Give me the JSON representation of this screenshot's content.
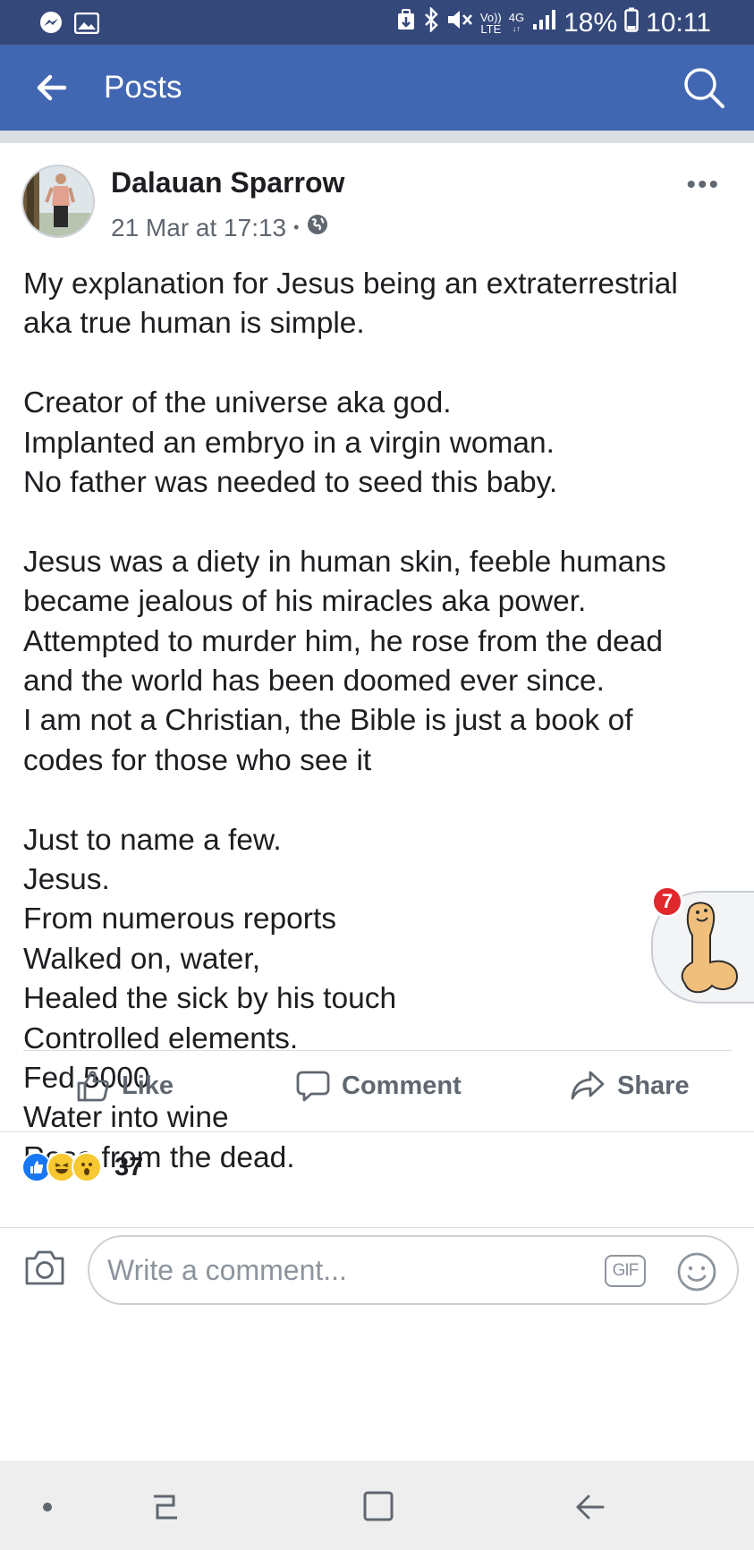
{
  "status_bar": {
    "network_top": "Vo))",
    "network_bottom": "LTE",
    "signal_gen_top": "4G",
    "signal_gen_bottom": "↓↑",
    "battery": "18%",
    "time": "10:11"
  },
  "app_bar": {
    "title": "Posts"
  },
  "post": {
    "author": "Dalauan Sparrow",
    "timestamp": "21 Mar at 17:13",
    "separator": "•",
    "more_label": "•••",
    "paragraphs": [
      [
        "My explanation for Jesus being an extraterrestrial",
        "aka true human is simple."
      ],
      [
        "Creator of the universe aka god.",
        "Implanted an embryo in a virgin woman.",
        "No father was needed to seed this baby."
      ],
      [
        "Jesus was a diety in human skin, feeble humans",
        "became jealous of his miracles aka power.",
        "Attempted to murder him, he rose from the dead",
        "and the world has been doomed ever since.",
        "I am not a Christian, the Bible is just a book of",
        "codes for those who see it"
      ],
      [
        "Just to name a few.",
        "Jesus.",
        "From numerous reports",
        "Walked on, water,",
        "Healed the sick by his touch",
        "Controlled elements.",
        "Fed 5000",
        "Water into wine",
        "Rose from the dead."
      ]
    ]
  },
  "actions": {
    "like_label": "Like",
    "comment_label": "Comment",
    "share_label": "Share"
  },
  "reactions": {
    "count": "37"
  },
  "composer": {
    "placeholder": "Write a comment...",
    "gif_label": "GIF"
  },
  "chat_head": {
    "badge_count": "7"
  },
  "colors": {
    "status_bar": "#34487a",
    "app_bar": "#4267b2",
    "like_blue": "#1877f2",
    "badge_red": "#e0282c"
  }
}
